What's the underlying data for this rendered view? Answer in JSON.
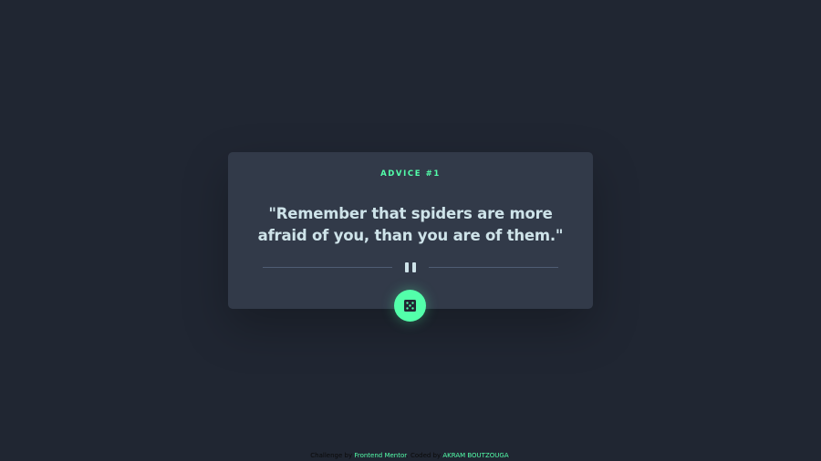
{
  "advice": {
    "label": "ADVICE #1",
    "quote": "\"Remember that spiders are more afraid of you, than you are of them.\""
  },
  "divider": {
    "icon": "pause-icon"
  },
  "dice_button": {
    "icon": "dice-icon"
  },
  "attribution": {
    "prefix": "Challenge by",
    "challenge_link": "Frontend Mentor",
    "middle": ". Coded by",
    "author_link": "AKRAM BOUTZOUGA",
    "suffix": "."
  },
  "colors": {
    "background": "#202632",
    "card": "#323a49",
    "accent": "#53ffaa",
    "text": "#cee3e9",
    "divider": "#4f5d74"
  }
}
